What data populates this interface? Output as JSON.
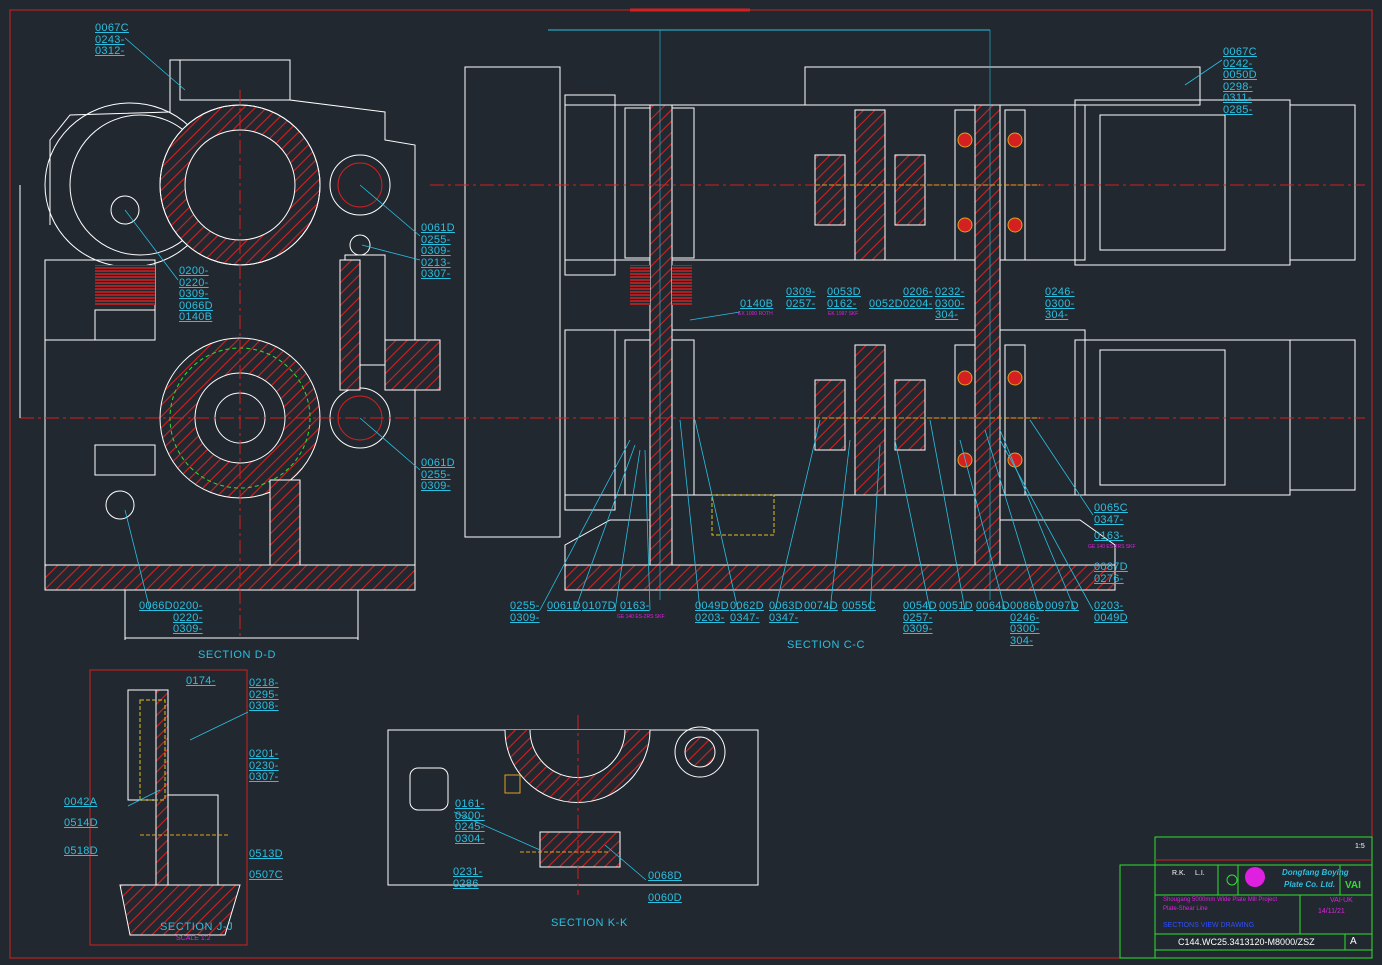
{
  "drawing": {
    "sections": {
      "dd": "SECTION D-D",
      "cc": "SECTION C-C",
      "jj": "SECTION J-J",
      "jj_scale": "SCALE 1:2",
      "kk": "SECTION K-K"
    },
    "labels": [
      [
        "0067C",
        "0243-",
        "0312-"
      ],
      [
        "0061D",
        "0255-",
        "0309-",
        "0213-",
        "0307-"
      ],
      [
        "0200-",
        "0220-",
        "0309-",
        "0066D",
        "0140B"
      ],
      [
        "0061D",
        "0255-",
        "0309-"
      ],
      [
        "0066D"
      ],
      [
        "0200-",
        "0220-",
        "0309-"
      ],
      [
        "0067C",
        "0242-",
        "0050D",
        "0298-",
        "0311-",
        "0285-"
      ],
      [
        "0140B"
      ],
      [
        "0309-",
        "0257-"
      ],
      [
        "0053D",
        "0162-"
      ],
      [
        "0052D"
      ],
      [
        "0206-",
        "0204-"
      ],
      [
        "0232-",
        "0300-",
        "304-"
      ],
      [
        "0246-",
        "0300-",
        "304-"
      ],
      [
        "0255-",
        "0309-"
      ],
      [
        "0061D"
      ],
      [
        "0107D"
      ],
      [
        "0163-"
      ],
      [
        "0049D",
        "0203-"
      ],
      [
        "0062D",
        "0347-"
      ],
      [
        "0063D",
        "0347-"
      ],
      [
        "0074D"
      ],
      [
        "0055C"
      ],
      [
        "0054D",
        "0257-",
        "0309-"
      ],
      [
        "0051D"
      ],
      [
        "0064D"
      ],
      [
        "0086D",
        "0246-",
        "0300-",
        "304-"
      ],
      [
        "0097D"
      ],
      [
        "0065C",
        "0347-"
      ],
      [
        "0163-"
      ],
      [
        "0087D",
        "0276-"
      ],
      [
        "0203-",
        "0049D"
      ],
      [
        "0174-"
      ],
      [
        "0218-",
        "0295-",
        "0308-"
      ],
      [
        "0201-",
        "0230-",
        "0307-"
      ],
      [
        "0042A"
      ],
      [
        "0514D"
      ],
      [
        "0518D"
      ],
      [
        "0513D"
      ],
      [
        "0507C"
      ],
      [
        "0161-",
        "0300-",
        "0245-",
        "0304-"
      ],
      [
        "0231-",
        "0286"
      ],
      [
        "0068D"
      ],
      [
        "0060D"
      ]
    ],
    "bearing_notes": {
      "b140": "EX 1000 ROTH",
      "b162": "EK 1997 SKF",
      "b163a": "GE 140 ES-2RS SKF",
      "b163b": "GE 140 ES-2RS SKF"
    }
  },
  "title_block": {
    "company_line1": "Dongfang Boying",
    "company_line2": "Plate Co. Ltd.",
    "vai_logo": "VAI",
    "project_line1": "Shougang 5000mm Wide Plate Mill Project",
    "project_line2": "Plate-Shear Line",
    "drawing_title": "SECTIONS VIEW DRAWING",
    "vendor": "VAI-UK",
    "date": "14/11/21",
    "drawing_number": "C144.WC25.3413120-M8000/ZSZ",
    "revision": "A",
    "scale": "1:5",
    "initials_1": "R.K.",
    "initials_2": "L.I."
  },
  "colors": {
    "background": "#212830",
    "outline": "#ffffff",
    "hatch": "#d42020",
    "label": "#2bbfe0",
    "note": "#e020e0",
    "frame": "#2ee02e"
  }
}
